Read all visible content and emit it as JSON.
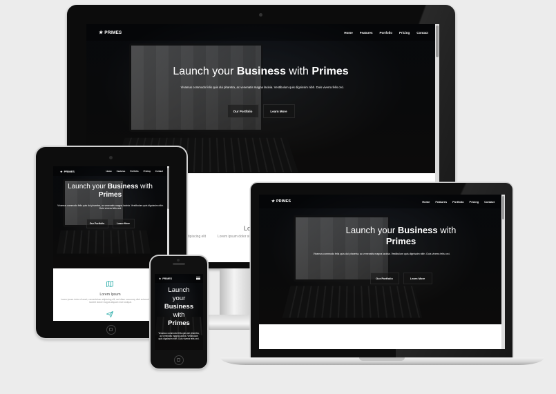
{
  "desktop": {
    "brand": "PRIMES",
    "nav": [
      "Home",
      "Features",
      "Portfolio",
      "Pricing",
      "Contact"
    ],
    "headline_pre": "Launch your ",
    "headline_b1": "Business",
    "headline_mid": " with ",
    "headline_b2": "Primes",
    "subtitle": "Vivamus commodo felis quis dui pharetra, ac venenatis magna lacinia. Vestibulum quis dignissim nibh. Duis viverra felis orci.",
    "btn_portfolio": "Our Portfolio",
    "btn_learn": "Learn More",
    "below_heading": "Lo",
    "below_col1": "adipiscing elit",
    "below_col2": "Lorem ipsum dolor si"
  },
  "tablet": {
    "brand": "PRIMES",
    "nav": [
      "Home",
      "Features",
      "Portfolio",
      "Pricing",
      "Contact"
    ],
    "headline_pre": "Launch your ",
    "headline_b1": "Business",
    "headline_mid": " with",
    "headline_b2": "Primes",
    "subtitle": "Vivamus commodo felis quis dui pharetra, ac venenatis magna lacinia. Vestibulum quis dignissim nibh. Duis viverra felis orci.",
    "btn_portfolio": "Our Portfolio",
    "btn_learn": "Learn More",
    "feature_title": "Lorem Ipsum",
    "feature_text": "Lorem ipsum dolor sit amet, consectetuer adipiscing elit, sed diam nonummy nibh euismod tincidunt ut laoreet dolore magna aliquam erat volutpat."
  },
  "phone": {
    "brand": "PRIMES",
    "headline_l1": "Launch",
    "headline_l2": "your",
    "headline_b1": "Business",
    "headline_mid": "with",
    "headline_b2": "Primes",
    "subtitle": "Vivamus commodo felis quis dui pharetra, ac venenatis magna lacinia. Vestibulum quis dignissim nibh. Duis viverra felis orci."
  },
  "laptop": {
    "brand": "PRIMES",
    "nav": [
      "Home",
      "Features",
      "Portfolio",
      "Pricing",
      "Contact"
    ],
    "headline_pre": "Launch your ",
    "headline_b1": "Business",
    "headline_mid": " with",
    "headline_b2": "Primes",
    "subtitle": "Vivamus commodo felis quis dui pharetra, ac venenatis magna lacinia. Vestibulum quis dignissim nibh. Duis viverra felis orci.",
    "btn_portfolio": "Our Portfolio",
    "btn_learn": "Learn More"
  },
  "icons": {
    "star": "star-icon",
    "menu": "hamburger-menu-icon",
    "map": "map-icon",
    "send": "paper-plane-icon"
  },
  "colors": {
    "accent": "#3cb3b0",
    "frame": "#111111",
    "silver": "#c9c9c9"
  }
}
